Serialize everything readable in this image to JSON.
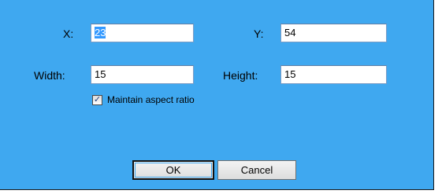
{
  "labels": {
    "x": "X:",
    "y": "Y:",
    "width": "Width:",
    "height": "Height:"
  },
  "fields": {
    "x_value": "23",
    "y_value": "54",
    "width_value": "15",
    "height_value": "15"
  },
  "aspect": {
    "label": "Maintain aspect ratio",
    "checked": true,
    "check_glyph": "✓"
  },
  "buttons": {
    "ok": "OK",
    "cancel": "Cancel"
  },
  "colors": {
    "panel_background": "#3fa8f0",
    "selection": "#3399ff"
  }
}
